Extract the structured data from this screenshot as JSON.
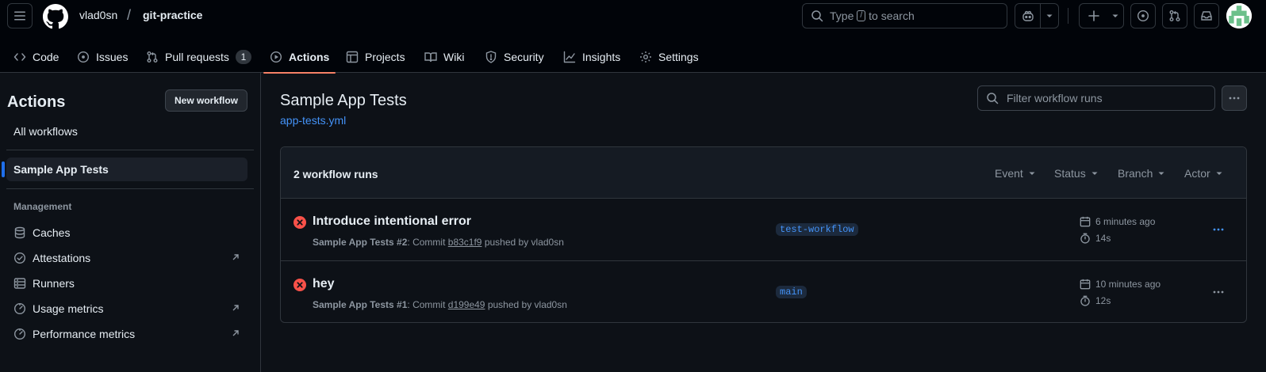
{
  "header": {
    "owner": "vlad0sn",
    "separator": "/",
    "repo": "git-practice",
    "search": {
      "prefix": "Type",
      "key": "/",
      "suffix": "to search"
    }
  },
  "tabs": [
    {
      "label": "Code",
      "icon": "code-icon"
    },
    {
      "label": "Issues",
      "icon": "issue-icon"
    },
    {
      "label": "Pull requests",
      "icon": "pull-request-icon",
      "count": "1"
    },
    {
      "label": "Actions",
      "icon": "play-icon",
      "active": true
    },
    {
      "label": "Projects",
      "icon": "table-icon"
    },
    {
      "label": "Wiki",
      "icon": "book-icon"
    },
    {
      "label": "Security",
      "icon": "shield-icon"
    },
    {
      "label": "Insights",
      "icon": "graph-icon"
    },
    {
      "label": "Settings",
      "icon": "gear-icon"
    }
  ],
  "sidebar": {
    "title": "Actions",
    "new_workflow": "New workflow",
    "all_workflows": "All workflows",
    "selected_workflow": "Sample App Tests",
    "management_heading": "Management",
    "management": [
      {
        "label": "Caches",
        "icon": "database-icon"
      },
      {
        "label": "Attestations",
        "icon": "verified-icon"
      },
      {
        "label": "Runners",
        "icon": "server-icon"
      },
      {
        "label": "Usage metrics",
        "icon": "meter-icon"
      },
      {
        "label": "Performance metrics",
        "icon": "meter-icon"
      }
    ]
  },
  "main": {
    "title": "Sample App Tests",
    "file": "app-tests.yml",
    "filter_placeholder": "Filter workflow runs",
    "count": "2 workflow runs",
    "filters": [
      "Event",
      "Status",
      "Branch",
      "Actor"
    ],
    "runs": [
      {
        "title": "Introduce intentional error",
        "workflow": "Sample App Tests",
        "number": "#2",
        "commit_label": "Commit",
        "sha": "b83c1f9",
        "pushed_by": "pushed by vlad0sn",
        "branch": "test-workflow",
        "when": "6 minutes ago",
        "duration": "14s",
        "status": "failure"
      },
      {
        "title": "hey",
        "workflow": "Sample App Tests",
        "number": "#1",
        "commit_label": "Commit",
        "sha": "d199e49",
        "pushed_by": "pushed by vlad0sn",
        "branch": "main",
        "when": "10 minutes ago",
        "duration": "12s",
        "status": "failure"
      }
    ]
  },
  "colors": {
    "accent": "#4493f8",
    "failure": "#f85149",
    "tab_underline": "#f78166",
    "selected_bar": "#1f6feb"
  }
}
